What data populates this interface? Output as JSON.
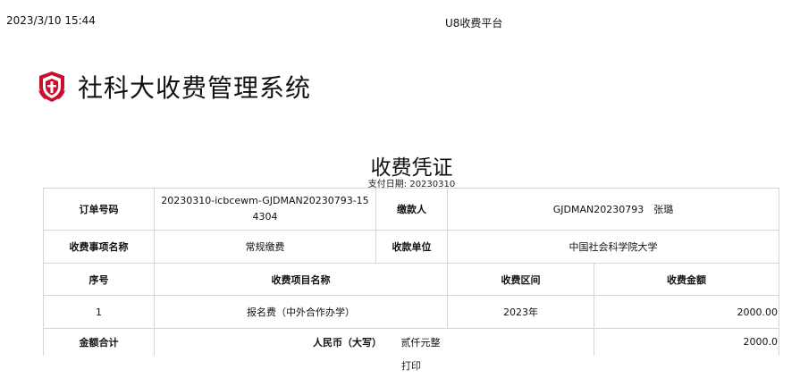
{
  "header": {
    "timestamp": "2023/3/10 15:44",
    "platform": "U8收费平台"
  },
  "brand": {
    "system_title": "社科大收费管理系统",
    "logo_color": "#c8102e"
  },
  "voucher": {
    "title": "收费凭证",
    "pay_date_label": "支付日期:",
    "pay_date": "20230310",
    "labels": {
      "order_no": "订单号码",
      "payer": "缴款人",
      "item_name": "收费事项名称",
      "payee_unit": "收款单位",
      "seq": "序号",
      "fee_item_name": "收费项目名称",
      "fee_period": "收费区间",
      "fee_amount": "收费金额",
      "total": "金额合计",
      "rmb_upper": "人民币（大写）"
    },
    "order_no": "20230310-icbcewm-GJDMAN20230793-154304",
    "payer": "GJDMAN20230793　张璐",
    "item_name": "常规缴费",
    "payee_unit": "中国社会科学院大学",
    "rows": [
      {
        "seq": "1",
        "name": "报名费（中外合作办学）",
        "period": "2023年",
        "amount": "2000.00"
      }
    ],
    "total_upper": "贰仟元整",
    "total_amount": "2000.0"
  },
  "actions": {
    "print": "打印"
  }
}
